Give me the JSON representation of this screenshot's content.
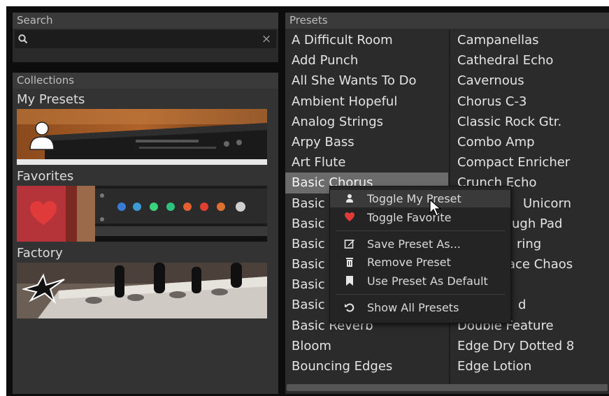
{
  "search": {
    "header": "Search",
    "value": "",
    "placeholder": "",
    "clear_glyph": "×",
    "icon": "search-icon"
  },
  "collections": {
    "header": "Collections",
    "items": [
      {
        "label": "My Presets",
        "icon": "user-icon"
      },
      {
        "label": "Favorites",
        "icon": "heart-icon"
      },
      {
        "label": "Factory",
        "icon": "bird-logo-icon"
      }
    ]
  },
  "presets": {
    "header": "Presets",
    "selected": "Basic Chorus",
    "column1": [
      "A Difficult Room",
      "Add Punch",
      "All She Wants To Do",
      "Ambient Hopeful",
      "Analog Strings",
      "Arpy Bass",
      "Art Flute",
      "Basic Chorus",
      "Basic",
      "Basic",
      "Basic",
      "Basic",
      "Basic",
      "Basic",
      "Basic Reverb",
      "Bloom",
      "Bouncing Edges"
    ],
    "column2": [
      "Campanellas",
      "Cathedral Echo",
      "Cavernous",
      "Chorus C-3",
      "Classic Rock Gtr.",
      "Combo Amp",
      "Compact Enricher",
      "Crunch Echo",
      "Unicorn",
      "ugh Pad",
      "ring",
      "ace Chaos",
      "",
      "d",
      "Double Feature",
      "Edge Dry Dotted 8",
      "Edge Lotion"
    ]
  },
  "context_menu": {
    "items": [
      {
        "label": "Toggle My Preset",
        "icon": "user-icon"
      },
      {
        "label": "Toggle Favorite",
        "icon": "heart-icon"
      },
      {
        "label": "Save Preset As...",
        "icon": "save-edit-icon"
      },
      {
        "label": "Remove Preset",
        "icon": "trash-icon"
      },
      {
        "label": "Use Preset As Default",
        "icon": "bookmark-icon"
      },
      {
        "label": "Show All Presets",
        "icon": "undo-icon"
      }
    ],
    "highlighted": "Toggle My Preset"
  },
  "colors": {
    "panel": "#333333",
    "header": "#3a3a3a",
    "selection": "#6b6b6b",
    "heart": "#e03a3a"
  }
}
